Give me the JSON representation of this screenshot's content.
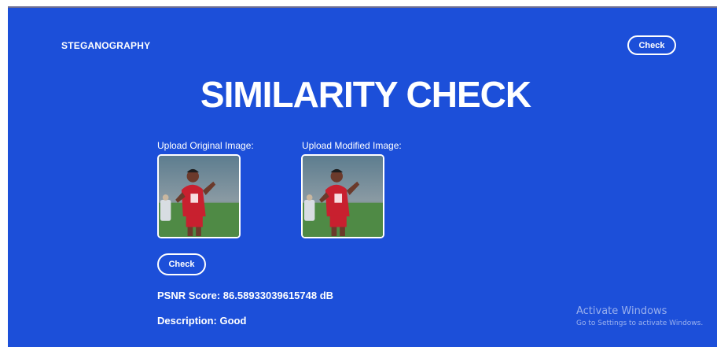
{
  "header": {
    "brand": "STEGANOGRAPHY",
    "check_label": "Check"
  },
  "main": {
    "title": "SIMILARITY CHECK",
    "original_label": "Upload Original Image:",
    "modified_label": "Upload Modified Image:",
    "check_label": "Check",
    "psnr_text": "PSNR Score: 86.58933039615748 dB",
    "description_text": "Description: Good"
  },
  "overlay": {
    "activate_title": "Activate Windows",
    "activate_sub": "Go to Settings to activate Windows."
  },
  "colors": {
    "background": "#1c4fd9",
    "text": "#ffffff",
    "jersey": "#c8202f"
  },
  "icons": {
    "original_image": "football-player-photo",
    "modified_image": "football-player-photo"
  }
}
